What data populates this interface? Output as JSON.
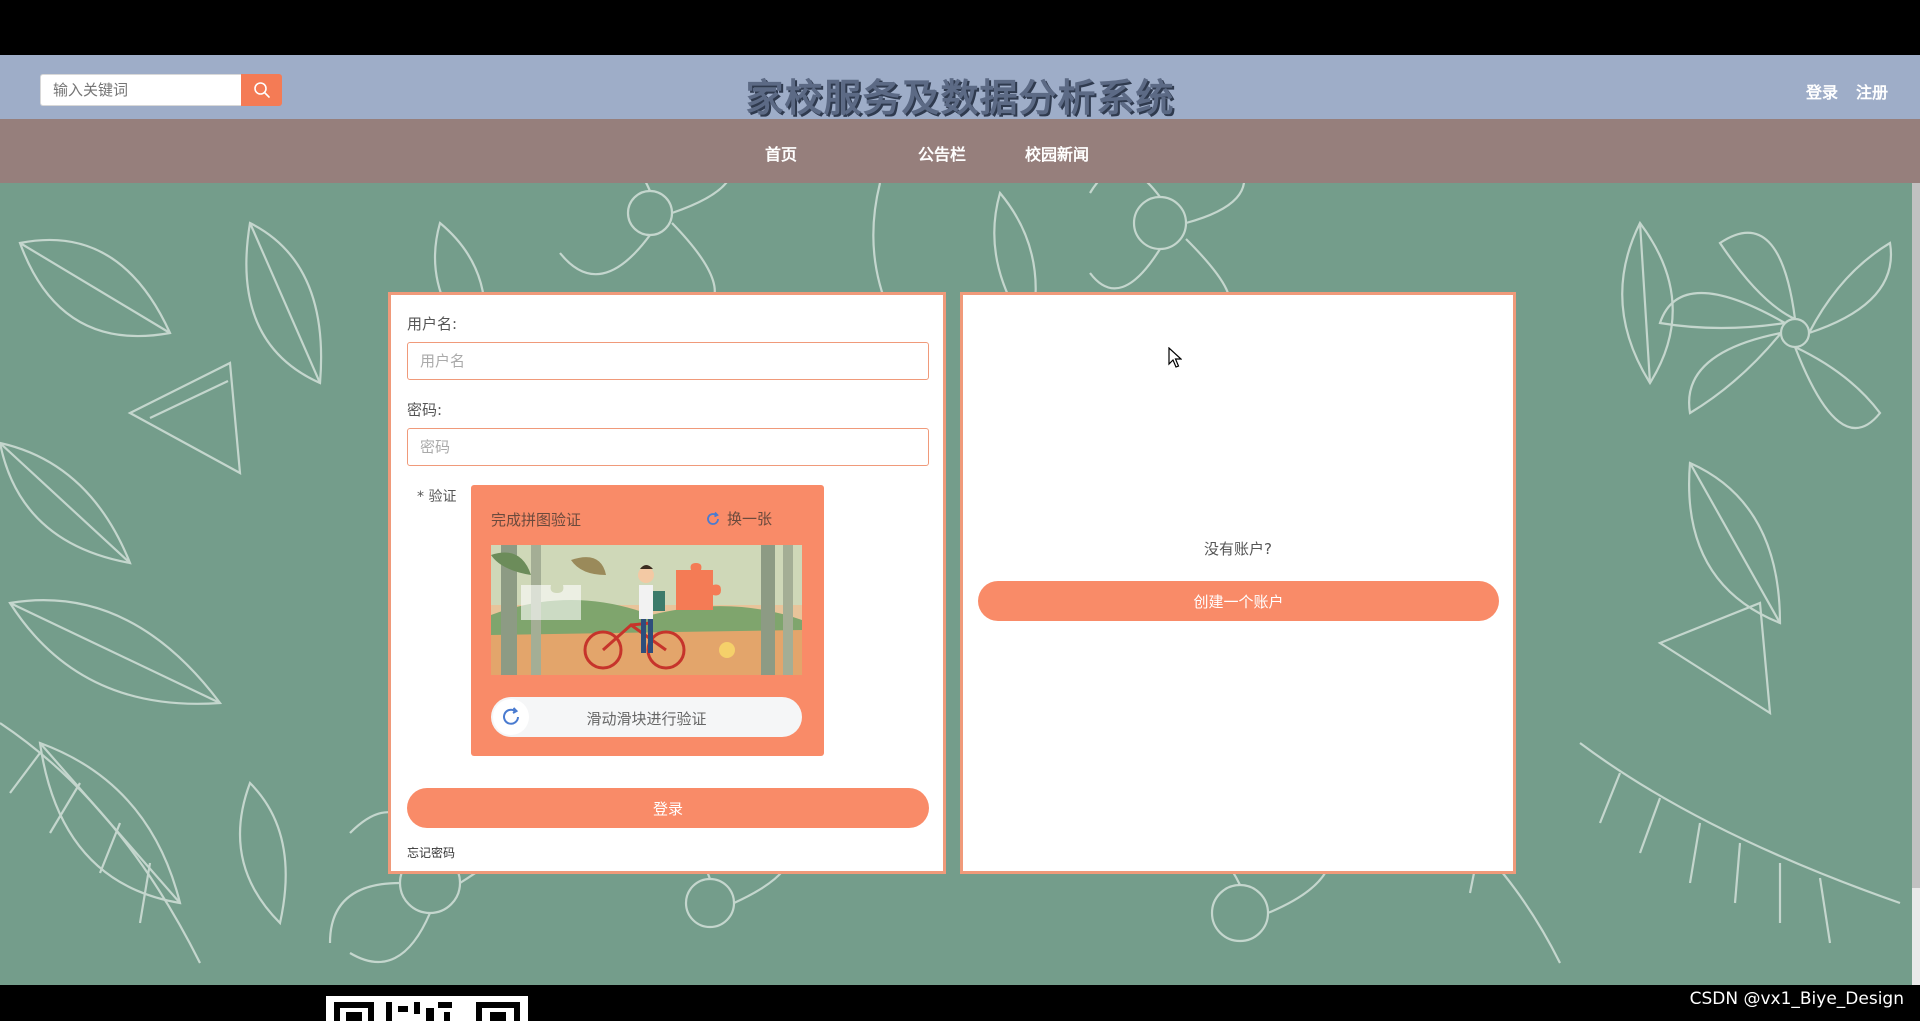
{
  "header": {
    "search_placeholder": "输入关键词",
    "site_title": "家校服务及数据分析系统",
    "login_link": "登录",
    "register_link": "注册"
  },
  "nav": {
    "items": [
      {
        "label": "首页"
      },
      {
        "label": "公告栏"
      },
      {
        "label": "校园新闻"
      }
    ]
  },
  "login_form": {
    "username_label": "用户名:",
    "username_placeholder": "用户名",
    "password_label": "密码:",
    "password_placeholder": "密码",
    "verify_label": "* 验证",
    "captcha_title": "完成拼图验证",
    "captcha_refresh": "换一张",
    "slider_text": "滑动滑块进行验证",
    "submit_label": "登录",
    "forgot_label": "忘记密码"
  },
  "register_panel": {
    "no_account_text": "没有账户?",
    "create_button": "创建一个账户"
  },
  "watermark": "CSDN @vx1_Biye_Design",
  "colors": {
    "header_bg": "#9eadc8",
    "nav_bg": "#967f7c",
    "page_bg": "#749d8b",
    "accent": "#f98b68"
  }
}
